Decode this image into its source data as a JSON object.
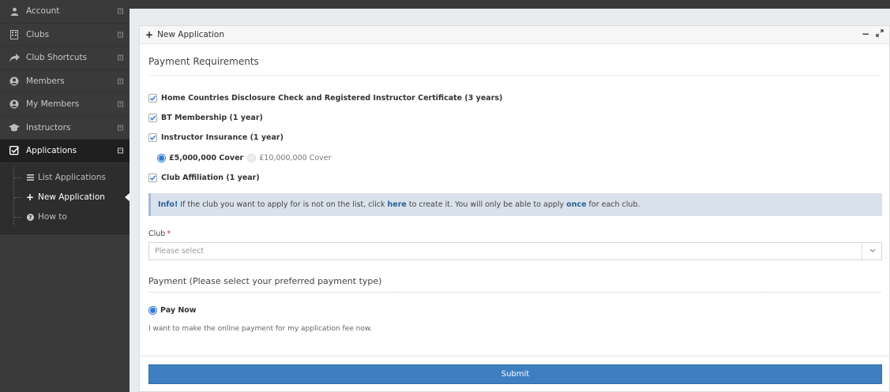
{
  "sidebar": {
    "items": [
      {
        "label": "Account",
        "icon": "user-icon"
      },
      {
        "label": "Clubs",
        "icon": "building-icon"
      },
      {
        "label": "Club Shortcuts",
        "icon": "share-icon"
      },
      {
        "label": "Members",
        "icon": "user-circle-icon"
      },
      {
        "label": "My Members",
        "icon": "user-circle-icon"
      },
      {
        "label": "Instructors",
        "icon": "graduation-cap-icon"
      },
      {
        "label": "Applications",
        "icon": "check-square-icon"
      }
    ],
    "submenu": [
      {
        "label": "List Applications",
        "icon": "list-icon"
      },
      {
        "label": "New Application",
        "icon": "plus-icon"
      },
      {
        "label": "How to",
        "icon": "question-circle-icon"
      }
    ]
  },
  "panel": {
    "title": "New Application",
    "section_title": "Payment Requirements",
    "requirements": [
      "Home Countries Disclosure Check and Registered Instructor Certificate (3 years)",
      "BT Membership (1 year)",
      "Instructor Insurance (1 year)",
      "Club Affiliation (1 year)"
    ],
    "cover_options": {
      "selected": "£5,000,000 Cover",
      "other": "£10,000,000 Cover"
    },
    "info": {
      "strong": "Info!",
      "text_before": "If the club you want to apply for is not on the list, click",
      "link": "here",
      "text_middle": "to create it. You will only be able to apply",
      "emph": "once",
      "text_after": "for each club."
    },
    "club_field": {
      "label": "Club",
      "required_mark": "*",
      "placeholder": "Please select"
    },
    "payment": {
      "title": "Payment (Please select your preferred payment type)",
      "option": "Pay Now",
      "description": "I want to make the online payment for my application fee now."
    },
    "submit_label": "Submit"
  },
  "colors": {
    "sidebar_bg": "#3a3a3a",
    "active_bg": "#1f1f1f",
    "accent": "#3f7fc1",
    "info_bg": "#d9e2ec"
  }
}
